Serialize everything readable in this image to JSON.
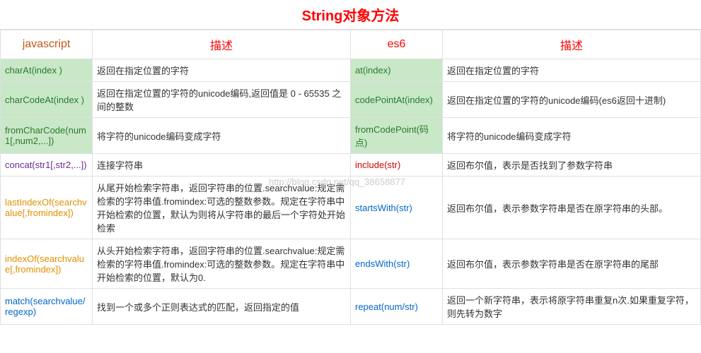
{
  "title": "String对象方法",
  "watermark": "http://blog.csdn.net/qq_38658877",
  "headers": {
    "js": "javascript",
    "desc1": "描述",
    "es6": "es6",
    "desc2": "描述"
  },
  "rows": [
    {
      "js": "charAt(index )",
      "jsClass": "green-cell",
      "desc1": "返回在指定位置的字符",
      "es6": "at(index)",
      "es6Class": "green-cell",
      "desc2": "返回在指定位置的字符"
    },
    {
      "js": "charCodeAt(index )",
      "jsClass": "green-cell",
      "desc1": "返回在指定位置的字符的unicode编码,返回值是 0 - 65535 之间的整数",
      "es6": "codePointAt(index)",
      "es6Class": "green-cell",
      "desc2": "返回在指定位置的字符的unicode编码(es6返回十进制)"
    },
    {
      "js": "fromCharCode(num1[,num2,...])",
      "jsClass": "green-cell",
      "desc1": "将字符的unicode编码变成字符",
      "es6": "fromCodePoint(码点)",
      "es6Class": "green-cell",
      "desc2": "将字符的unicode编码变成字符"
    },
    {
      "js": "concat(str1[,str2,...])",
      "jsClass": "purple",
      "desc1": "连接字符串",
      "es6": "include(str)",
      "es6Class": "red",
      "desc2": "返回布尔值，表示是否找到了参数字符串"
    },
    {
      "js": "lastIndexOf(searchvalue[,fromindex])",
      "jsClass": "orange",
      "desc1": "从尾开始检索字符串，返回字符串的位置.searchvalue:规定需检索的字符串值.fromindex:可选的整数参数。规定在字符串中开始检索的位置，默认为则将从字符串的最后一个字符处开始检索",
      "es6": "startsWith(str)",
      "es6Class": "blue",
      "desc2": "返回布尔值，表示参数字符串是否在原字符串的头部。"
    },
    {
      "js": "indexOf(searchvalue[,fromindex])",
      "jsClass": "orange",
      "desc1": "从头开始检索字符串，返回字符串的位置.searchvalue:规定需检索的字符串值.fromindex:可选的整数参数。规定在字符串中开始检索的位置，默认为0.",
      "es6": "endsWith(str)",
      "es6Class": "blue",
      "desc2": "返回布尔值，表示参数字符串是否在原字符串的尾部"
    },
    {
      "js": "match(searchvalue/regexp)",
      "jsClass": "blue",
      "desc1": "找到一个或多个正则表达式的匹配，返回指定的值",
      "es6": "repeat(num/str)",
      "es6Class": "blue",
      "desc2": "返回一个新字符串，表示将原字符串重复n次.如果重复字符，则先转为数字"
    }
  ]
}
